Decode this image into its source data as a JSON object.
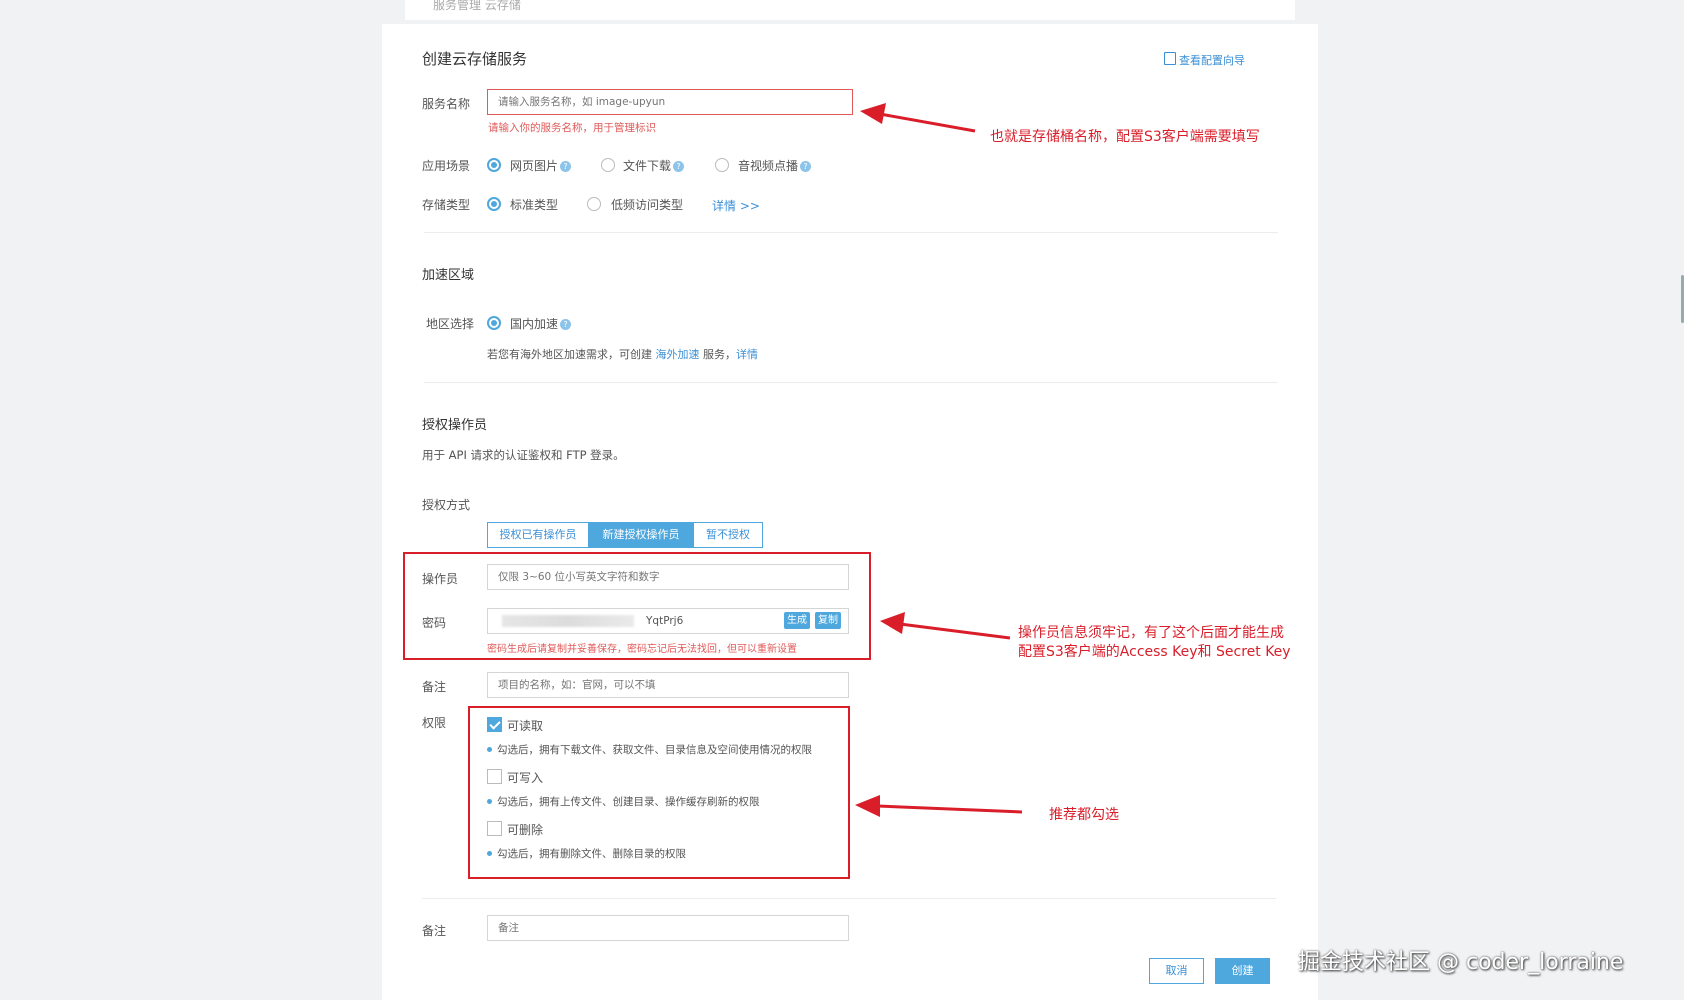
{
  "breadcrumb": "服务管理 云存储",
  "page": {
    "title": "创建云存储服务",
    "guide_link": "查看配置向导"
  },
  "service_name": {
    "label": "服务名称",
    "placeholder": "请输入服务名称，如 image-upyun",
    "error": "请输入你的服务名称，用于管理标识"
  },
  "scenario": {
    "label": "应用场景",
    "options": [
      "网页图片",
      "文件下载",
      "音视频点播"
    ],
    "selected": "网页图片"
  },
  "storage_type": {
    "label": "存储类型",
    "options": [
      "标准类型",
      "低频访问类型"
    ],
    "selected": "标准类型",
    "details_link": "详情 >>"
  },
  "region": {
    "section_title": "加速区域",
    "label": "地区选择",
    "option": "国内加速",
    "note_prefix": "若您有海外地区加速需求，可创建",
    "overseas_link": "海外加速",
    "note_mid": "服务，",
    "details_link": "详情"
  },
  "operator": {
    "section_title": "授权操作员",
    "description": "用于 API 请求的认证鉴权和 FTP 登录。",
    "auth_label": "授权方式",
    "auth_options": [
      "授权已有操作员",
      "新建授权操作员",
      "暂不授权"
    ],
    "auth_selected": "新建授权操作员",
    "operator_label": "操作员",
    "operator_placeholder": "仅限 3~60 位小写英文字符和数字",
    "password_label": "密码",
    "password_value_suffix": "YqtPrj6",
    "generate_btn": "生成",
    "copy_btn": "复制",
    "password_warning": "密码生成后请复制并妥善保存，密码忘记后无法找回，但可以重新设置",
    "remark_label": "备注",
    "remark_placeholder": "项目的名称，如：官网，可以不填"
  },
  "permissions": {
    "label": "权限",
    "items": [
      {
        "name": "可读取",
        "checked": true,
        "desc": "勾选后，拥有下载文件、获取文件、目录信息及空间使用情况的权限"
      },
      {
        "name": "可写入",
        "checked": false,
        "desc": "勾选后，拥有上传文件、创建目录、操作缓存刷新的权限"
      },
      {
        "name": "可删除",
        "checked": false,
        "desc": "勾选后，拥有删除文件、删除目录的权限"
      }
    ]
  },
  "footer": {
    "remark_label": "备注",
    "remark_placeholder": "备注",
    "cancel_btn": "取消",
    "create_btn": "创建"
  },
  "annotations": {
    "bucket": "也就是存储桶名称，配置S3客户端需要填写",
    "operator_line1": "操作员信息须牢记，有了这个后面才能生成",
    "operator_line2": "配置S3客户端的Access Key和 Secret Key",
    "permissions": "推荐都勾选"
  },
  "watermark": "掘金技术社区 @ coder_lorraine",
  "colors": {
    "accent": "#4ea7dd",
    "annotation_red": "#d91e2a",
    "error_red": "#e05a5a"
  }
}
